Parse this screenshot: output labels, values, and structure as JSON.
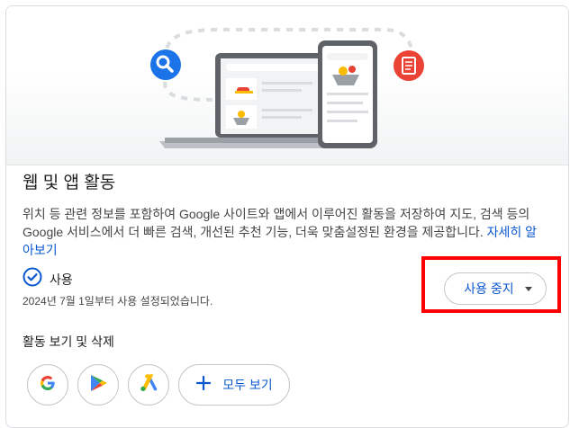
{
  "activity": {
    "title": "웹 및 앱 활동",
    "description": "위치 등 관련 정보를 포함하여 Google 사이트와 앱에서 이루어진 활동을 저장하여 지도, 검색 등의 Google 서비스에서 더 빠른 검색, 개선된 추천 기능, 더욱 맞춤설정된 환경을 제공합니다.",
    "learn_more": "자세히 알아보기",
    "status": "사용",
    "since": "2024년 7월 1일부터 사용 설정되었습니다.",
    "pause_button": "사용 중지",
    "view_delete_title": "활동 보기 및 삭제",
    "view_all_button": "모두 보기"
  },
  "apps": [
    "google-icon",
    "play-store-icon",
    "google-ads-icon"
  ],
  "colors": {
    "accent": "#0b57d0",
    "status_check": "#0b57d0",
    "highlight_box": "#ff0000",
    "search_badge": "#1a73e8",
    "doc_badge": "#ea4335"
  }
}
